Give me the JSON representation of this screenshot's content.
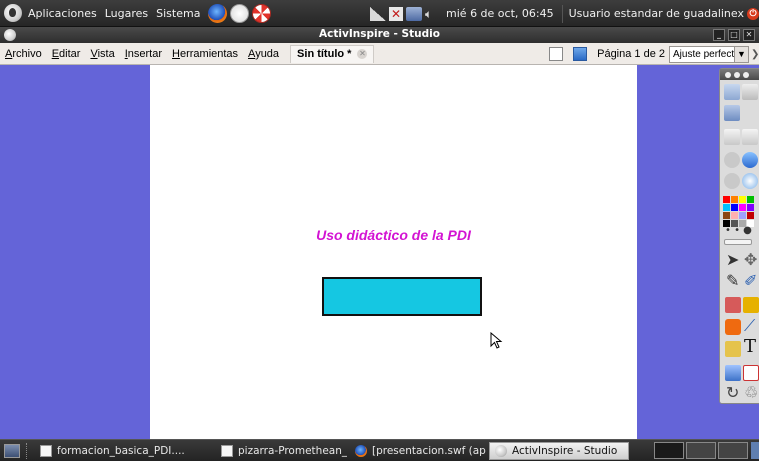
{
  "top_panel": {
    "menus": [
      "Aplicaciones",
      "Lugares",
      "Sistema"
    ],
    "launchers": [
      "firefox-icon",
      "mail-icon",
      "help-icon"
    ],
    "clock": "mié  6 de oct, 06:45",
    "user": "Usuario estandar de guadalinex"
  },
  "window": {
    "title": "ActivInspire - Studio"
  },
  "menu_bar": {
    "items": [
      {
        "mnemonic": "A",
        "rest": "rchivo"
      },
      {
        "mnemonic": "E",
        "rest": "ditar"
      },
      {
        "mnemonic": "V",
        "rest": "ista"
      },
      {
        "mnemonic": "I",
        "rest": "nsertar"
      },
      {
        "mnemonic": "H",
        "rest": "erramientas"
      },
      {
        "mnemonic": "A",
        "rest": "yuda"
      }
    ],
    "doc_tab": "Sin título *",
    "page_indicator": "Página 1 de 2",
    "zoom_value": "Ajuste perfecto"
  },
  "flipchart": {
    "title": "Uso didáctico de la PDI",
    "colors": {
      "background": "#ffffff",
      "workspace": "#6464d8",
      "title_text": "#d313d3",
      "rectangle_fill": "#15c7e2"
    }
  },
  "taskbar": {
    "tasks": [
      {
        "label": "formacion_basica_PDI....",
        "icon": "document-icon",
        "active": false
      },
      {
        "label": "pizarra-Promethean_P...",
        "icon": "document-icon",
        "active": false
      },
      {
        "label": "[presentacion.swf (ap...",
        "icon": "firefox-icon",
        "active": false
      },
      {
        "label": "ActivInspire - Studio",
        "icon": "activinspire-icon",
        "active": true
      }
    ]
  }
}
